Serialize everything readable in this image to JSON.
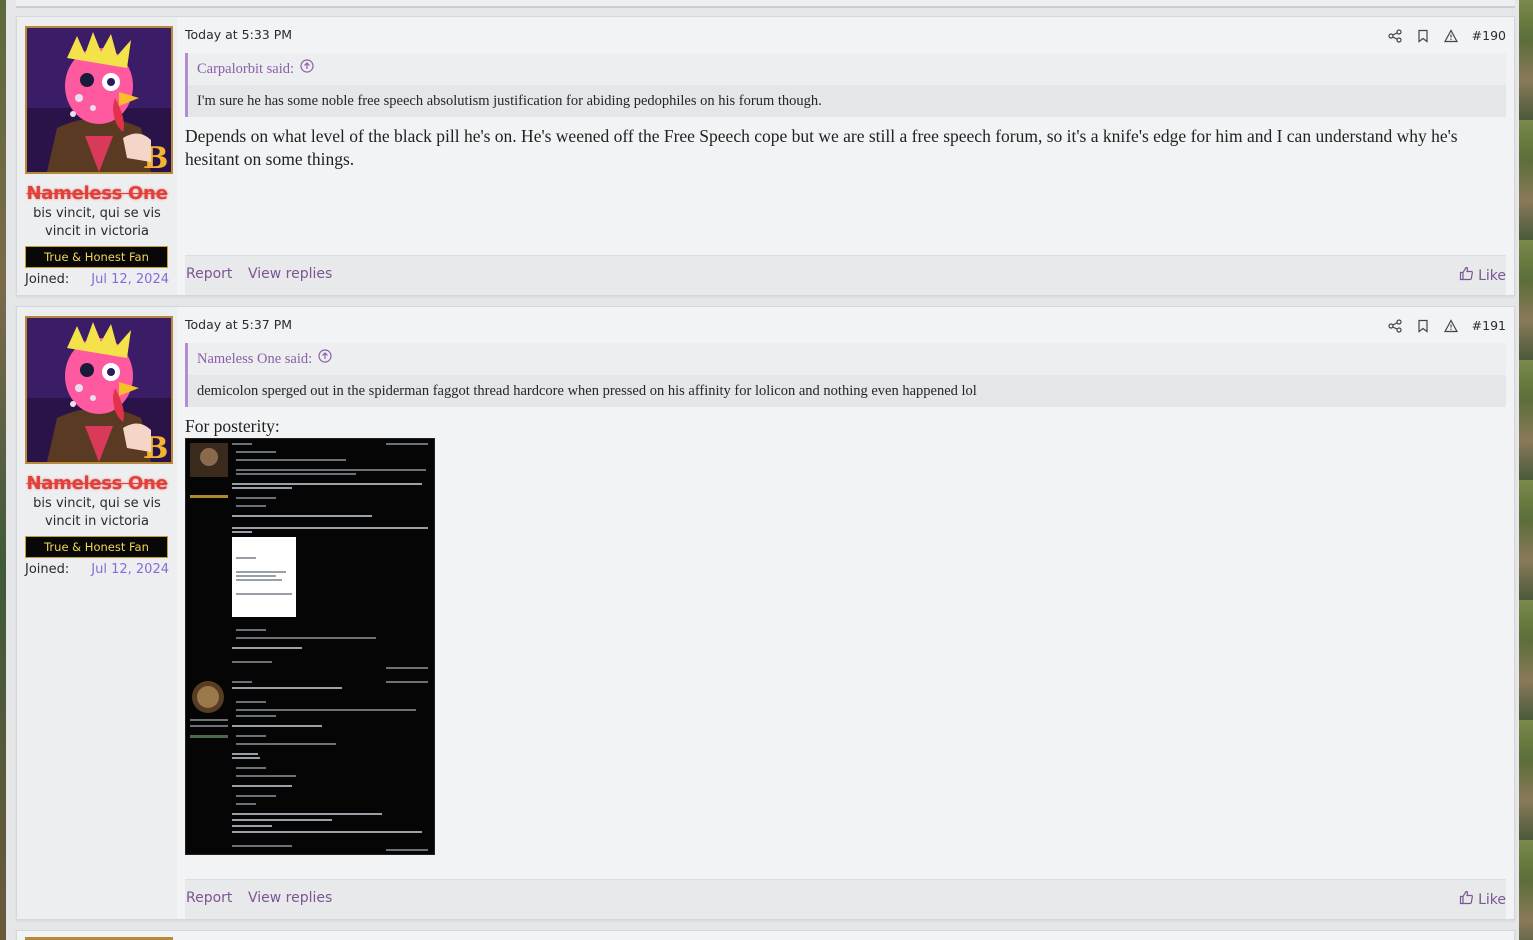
{
  "posts": [
    {
      "user": {
        "name": "Nameless One",
        "title": "bis vincit, qui se vis vincit in victoria",
        "banner": "True & Honest Fan",
        "joined_label": "Joined:",
        "joined_date": "Jul 12, 2024"
      },
      "date": "Today at 5:33 PM",
      "number": "#190",
      "quote": {
        "author": "Carpalorbit said:",
        "text": "I'm sure he has some noble free speech absolutism justification for abiding pedophiles on his forum though."
      },
      "message": "Depends on what level of the black pill he's on. He's weened off the Free Speech cope but we are still a free speech forum, so it's a knife's edge for him and I can understand why he's hesitant on some things.",
      "footer": {
        "report": "Report",
        "view_replies": "View replies",
        "like": "Like"
      }
    },
    {
      "user": {
        "name": "Nameless One",
        "title": "bis vincit, qui se vis vincit in victoria",
        "banner": "True & Honest Fan",
        "joined_label": "Joined:",
        "joined_date": "Jul 12, 2024"
      },
      "date": "Today at 5:37 PM",
      "number": "#191",
      "quote": {
        "author": "Nameless One said:",
        "text": "demicolon sperged out in the spiderman faggot thread hardcore when pressed on his affinity for lolicon and nothing even happened lol"
      },
      "message": "For posterity:",
      "footer": {
        "report": "Report",
        "view_replies": "View replies",
        "like": "Like"
      }
    }
  ],
  "icons": {
    "share": "share-icon",
    "bookmark": "bookmark-icon",
    "report": "warning-icon",
    "quote_up": "arrow-up-circle-icon",
    "like": "thumbs-up-icon"
  },
  "colors": {
    "username": "#e0413a",
    "link": "#7c5592",
    "quote_border": "#b58bd4",
    "joined_date": "#8b6ad6",
    "banner_text": "#f2d45a",
    "avatar_frame": "#b78a3a"
  }
}
